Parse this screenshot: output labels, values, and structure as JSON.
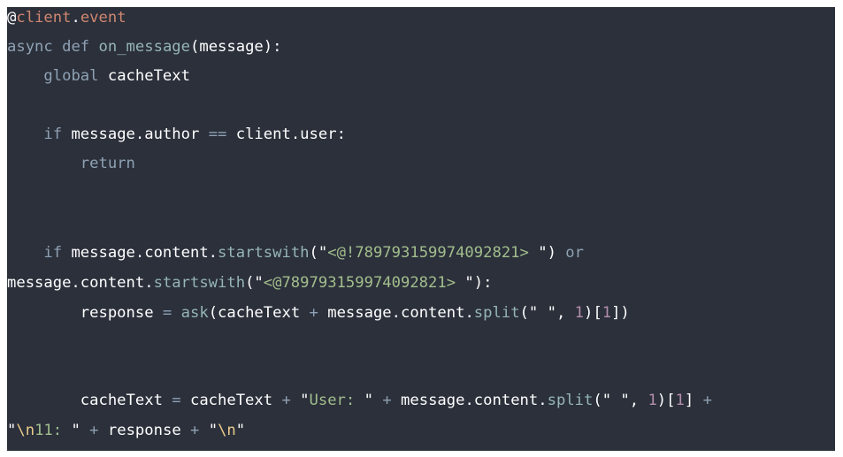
{
  "colors": {
    "background": "#2b303b",
    "plain": "#ffffff",
    "keyword": "#8fa1b3",
    "def": "#96b5b4",
    "decor": "#d08770",
    "builtin": "#96b5b4",
    "string": "#a3be8c",
    "number": "#b48ead",
    "escape": "#ebcb8b",
    "op": "#8fa1b3"
  },
  "code": {
    "language": "python",
    "lines": [
      [
        [
          "plain",
          "@"
        ],
        [
          "decor",
          "client"
        ],
        [
          "plain",
          "."
        ],
        [
          "decor",
          "event"
        ]
      ],
      [
        [
          "keyword",
          "async"
        ],
        [
          "plain",
          " "
        ],
        [
          "keyword",
          "def"
        ],
        [
          "plain",
          " "
        ],
        [
          "def",
          "on_message"
        ],
        [
          "plain",
          "(message):"
        ]
      ],
      [
        [
          "plain",
          "    "
        ],
        [
          "keyword",
          "global"
        ],
        [
          "plain",
          " cacheText"
        ]
      ],
      [],
      [
        [
          "plain",
          "    "
        ],
        [
          "keyword",
          "if"
        ],
        [
          "plain",
          " message.author "
        ],
        [
          "op",
          "=="
        ],
        [
          "plain",
          " client.user:"
        ]
      ],
      [
        [
          "plain",
          "        "
        ],
        [
          "keyword",
          "return"
        ]
      ],
      [],
      [],
      [
        [
          "plain",
          "    "
        ],
        [
          "keyword",
          "if"
        ],
        [
          "plain",
          " message.content."
        ],
        [
          "builtin",
          "startswith"
        ],
        [
          "plain",
          "(\""
        ],
        [
          "string",
          "<@!789793159974092821> "
        ],
        [
          "plain",
          "\") "
        ],
        [
          "keyword",
          "or"
        ]
      ],
      [
        [
          "plain",
          "message.content."
        ],
        [
          "builtin",
          "startswith"
        ],
        [
          "plain",
          "(\""
        ],
        [
          "string",
          "<@789793159974092821> "
        ],
        [
          "plain",
          "\"):"
        ]
      ],
      [
        [
          "plain",
          "        response "
        ],
        [
          "op",
          "="
        ],
        [
          "plain",
          " "
        ],
        [
          "builtin",
          "ask"
        ],
        [
          "plain",
          "(cacheText "
        ],
        [
          "op",
          "+"
        ],
        [
          "plain",
          " message.content."
        ],
        [
          "builtin",
          "split"
        ],
        [
          "plain",
          "(\" \", "
        ],
        [
          "number",
          "1"
        ],
        [
          "plain",
          ")["
        ],
        [
          "number",
          "1"
        ],
        [
          "plain",
          "])"
        ]
      ],
      [],
      [],
      [
        [
          "plain",
          "        cacheText "
        ],
        [
          "op",
          "="
        ],
        [
          "plain",
          " cacheText "
        ],
        [
          "op",
          "+"
        ],
        [
          "plain",
          " \""
        ],
        [
          "string",
          "User: "
        ],
        [
          "plain",
          "\" "
        ],
        [
          "op",
          "+"
        ],
        [
          "plain",
          " message.content."
        ],
        [
          "builtin",
          "split"
        ],
        [
          "plain",
          "(\" \", "
        ],
        [
          "number",
          "1"
        ],
        [
          "plain",
          ")["
        ],
        [
          "number",
          "1"
        ],
        [
          "plain",
          "] "
        ],
        [
          "op",
          "+"
        ]
      ],
      [
        [
          "plain",
          "\""
        ],
        [
          "escape",
          "\\n"
        ],
        [
          "string",
          "11: "
        ],
        [
          "plain",
          "\" "
        ],
        [
          "op",
          "+"
        ],
        [
          "plain",
          " response "
        ],
        [
          "op",
          "+"
        ],
        [
          "plain",
          " \""
        ],
        [
          "escape",
          "\\n"
        ],
        [
          "plain",
          "\""
        ]
      ]
    ]
  }
}
